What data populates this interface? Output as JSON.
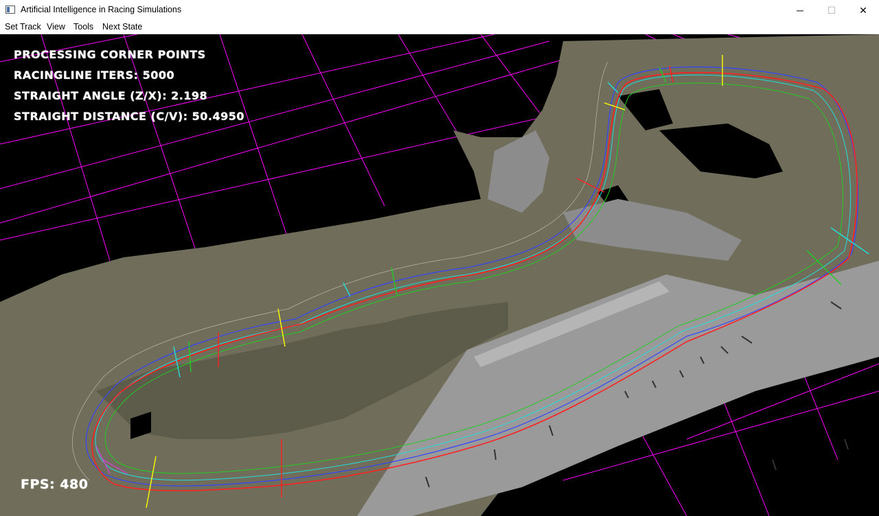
{
  "window": {
    "title": "Artificial Intelligence in Racing Simulations",
    "minimize_glyph": "─",
    "maximize_glyph": "☐",
    "close_glyph": "✕"
  },
  "menu": {
    "items": [
      "Set Track",
      "View",
      "Tools",
      "Next State"
    ]
  },
  "hud": {
    "status": "PROCESSING CORNER POINTS",
    "racingline_iters": "RACINGLINE ITERS: 5000",
    "straight_angle": "STRAIGHT ANGLE (Z/X): 2.198",
    "straight_distance": "STRAIGHT DISTANCE (C/V): 50.4950",
    "fps": "FPS: 480"
  },
  "colors": {
    "background": "#000000",
    "grid": "#ff00ff",
    "terrain": "#706e5a",
    "racing_line": "#ff2020",
    "inner_guide": "#22cc22",
    "outer_guide": "#3344ff",
    "center_guide": "#22dddd",
    "marker": "#ffff00"
  }
}
